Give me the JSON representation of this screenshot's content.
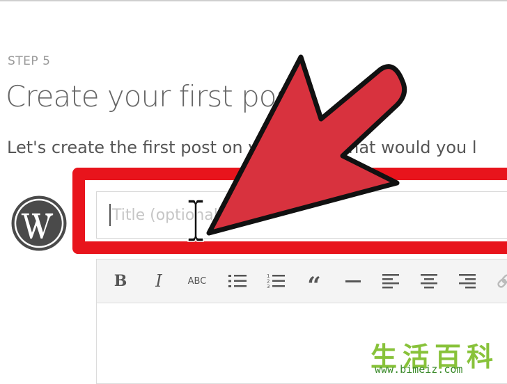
{
  "step": {
    "label": "STEP 5"
  },
  "heading": {
    "title": "Create your first post"
  },
  "intro": {
    "text": "Let's create the first post on your site. What would you l"
  },
  "title_field": {
    "placeholder": "Title (optional)"
  },
  "toolbar": {
    "bold_label": "B",
    "italic_label": "I",
    "strikethrough_label": "ABC",
    "blockquote_label": "“"
  },
  "watermark": {
    "cjk": "生活百科",
    "url": "www.bimeiz.com"
  },
  "colors": {
    "highlight": "#e8141c",
    "arrow_fill": "#d8323e",
    "arrow_stroke": "#111111",
    "watermark_green": "#88c23a"
  },
  "icons": [
    "wordpress-logo-icon",
    "text-cursor-icon",
    "bold-icon",
    "italic-icon",
    "strikethrough-icon",
    "bullet-list-icon",
    "numbered-list-icon",
    "blockquote-icon",
    "horizontal-rule-icon",
    "align-left-icon",
    "align-center-icon",
    "align-right-icon",
    "link-icon",
    "pointer-arrow-icon"
  ]
}
